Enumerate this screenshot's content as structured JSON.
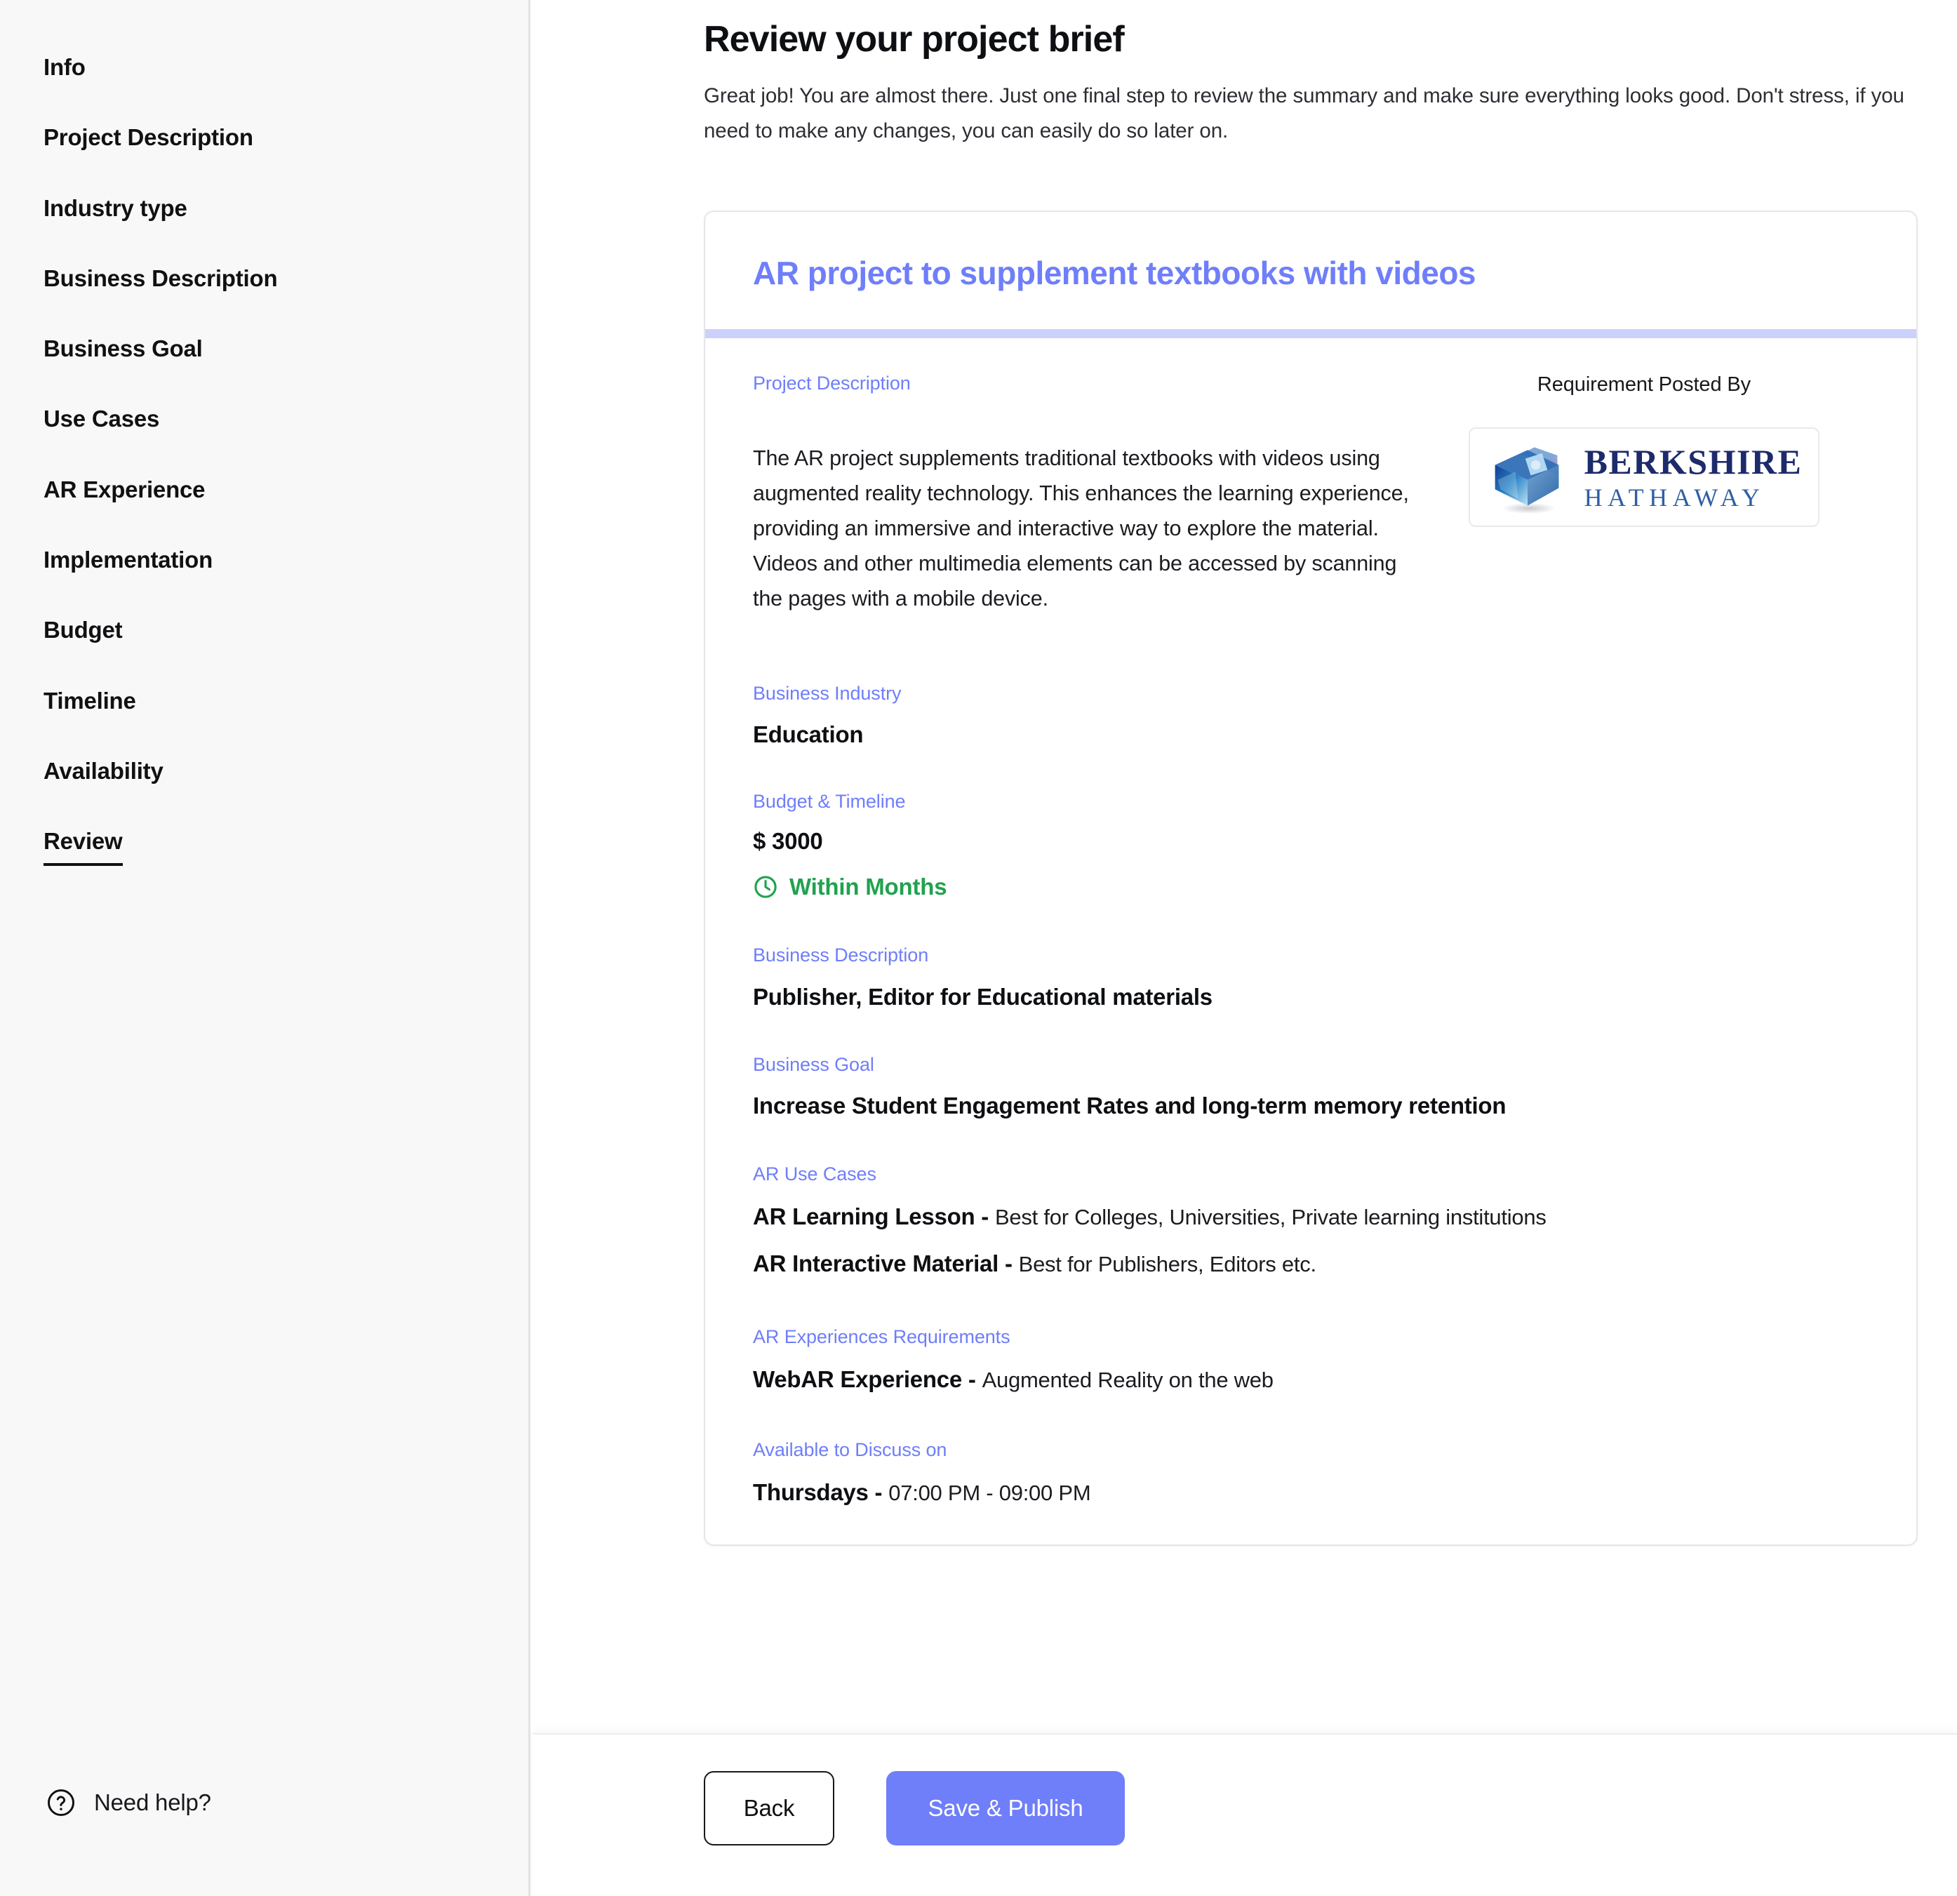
{
  "sidebar": {
    "items": [
      {
        "label": "Info",
        "active": false
      },
      {
        "label": "Project Description",
        "active": false
      },
      {
        "label": "Industry type",
        "active": false
      },
      {
        "label": "Business Description",
        "active": false
      },
      {
        "label": "Business Goal",
        "active": false
      },
      {
        "label": "Use Cases",
        "active": false
      },
      {
        "label": "AR Experience",
        "active": false
      },
      {
        "label": "Implementation",
        "active": false
      },
      {
        "label": "Budget",
        "active": false
      },
      {
        "label": "Timeline",
        "active": false
      },
      {
        "label": "Availability",
        "active": false
      },
      {
        "label": "Review",
        "active": true
      }
    ],
    "help": {
      "icon": "question-circle-icon",
      "label": "Need help?"
    }
  },
  "header": {
    "title": "Review your project brief",
    "subtitle": "Great job! You are almost there. Just one final step to review the summary and make sure everything looks good. Don't stress, if you need to make any changes, you can easily do so later on."
  },
  "brief": {
    "title": "AR project to supplement textbooks with videos",
    "project_description": {
      "label": "Project Description",
      "text": "The AR project supplements traditional textbooks with videos using augmented reality technology. This enhances the learning experience, providing an immersive and interactive way to explore the material. Videos and other multimedia elements can be accessed by scanning the pages with a mobile device."
    },
    "posted_by": {
      "label": "Requirement Posted By",
      "company_line1": "BERKSHIRE",
      "company_line2": "HATHAWAY",
      "logo_icon": "berkshire-hathaway-cube-logo"
    },
    "business_industry": {
      "label": "Business Industry",
      "value": "Education"
    },
    "budget_timeline": {
      "label": "Budget & Timeline",
      "budget": "$ 3000",
      "timeline": "Within Months",
      "timeline_icon": "clock-icon"
    },
    "business_description": {
      "label": "Business Description",
      "value": "Publisher, Editor for Educational materials"
    },
    "business_goal": {
      "label": "Business Goal",
      "value": "Increase Student Engagement Rates and long-term memory retention"
    },
    "ar_use_cases": {
      "label": "AR Use Cases",
      "items": [
        {
          "name": "AR Learning Lesson -",
          "desc": "Best for Colleges, Universities, Private learning institutions"
        },
        {
          "name": "AR Interactive Material -",
          "desc": "Best for Publishers, Editors etc."
        }
      ]
    },
    "ar_experiences": {
      "label": "AR Experiences Requirements",
      "items": [
        {
          "name": "WebAR Experience -",
          "desc": "Augmented Reality on the web"
        }
      ]
    },
    "availability": {
      "label": "Available to Discuss on",
      "day": "Thursdays -",
      "time": "07:00 PM - 09:00 PM"
    }
  },
  "footer": {
    "back_label": "Back",
    "publish_label": "Save & Publish"
  },
  "colors": {
    "accent": "#6f7ef9",
    "accent_soft": "#ccd0fc",
    "success": "#21a24f",
    "text": "#0e0f12",
    "sidebar_bg": "#f8f8f8",
    "logo_navy": "#1d2a6b",
    "logo_blue": "#2f5fa3"
  }
}
